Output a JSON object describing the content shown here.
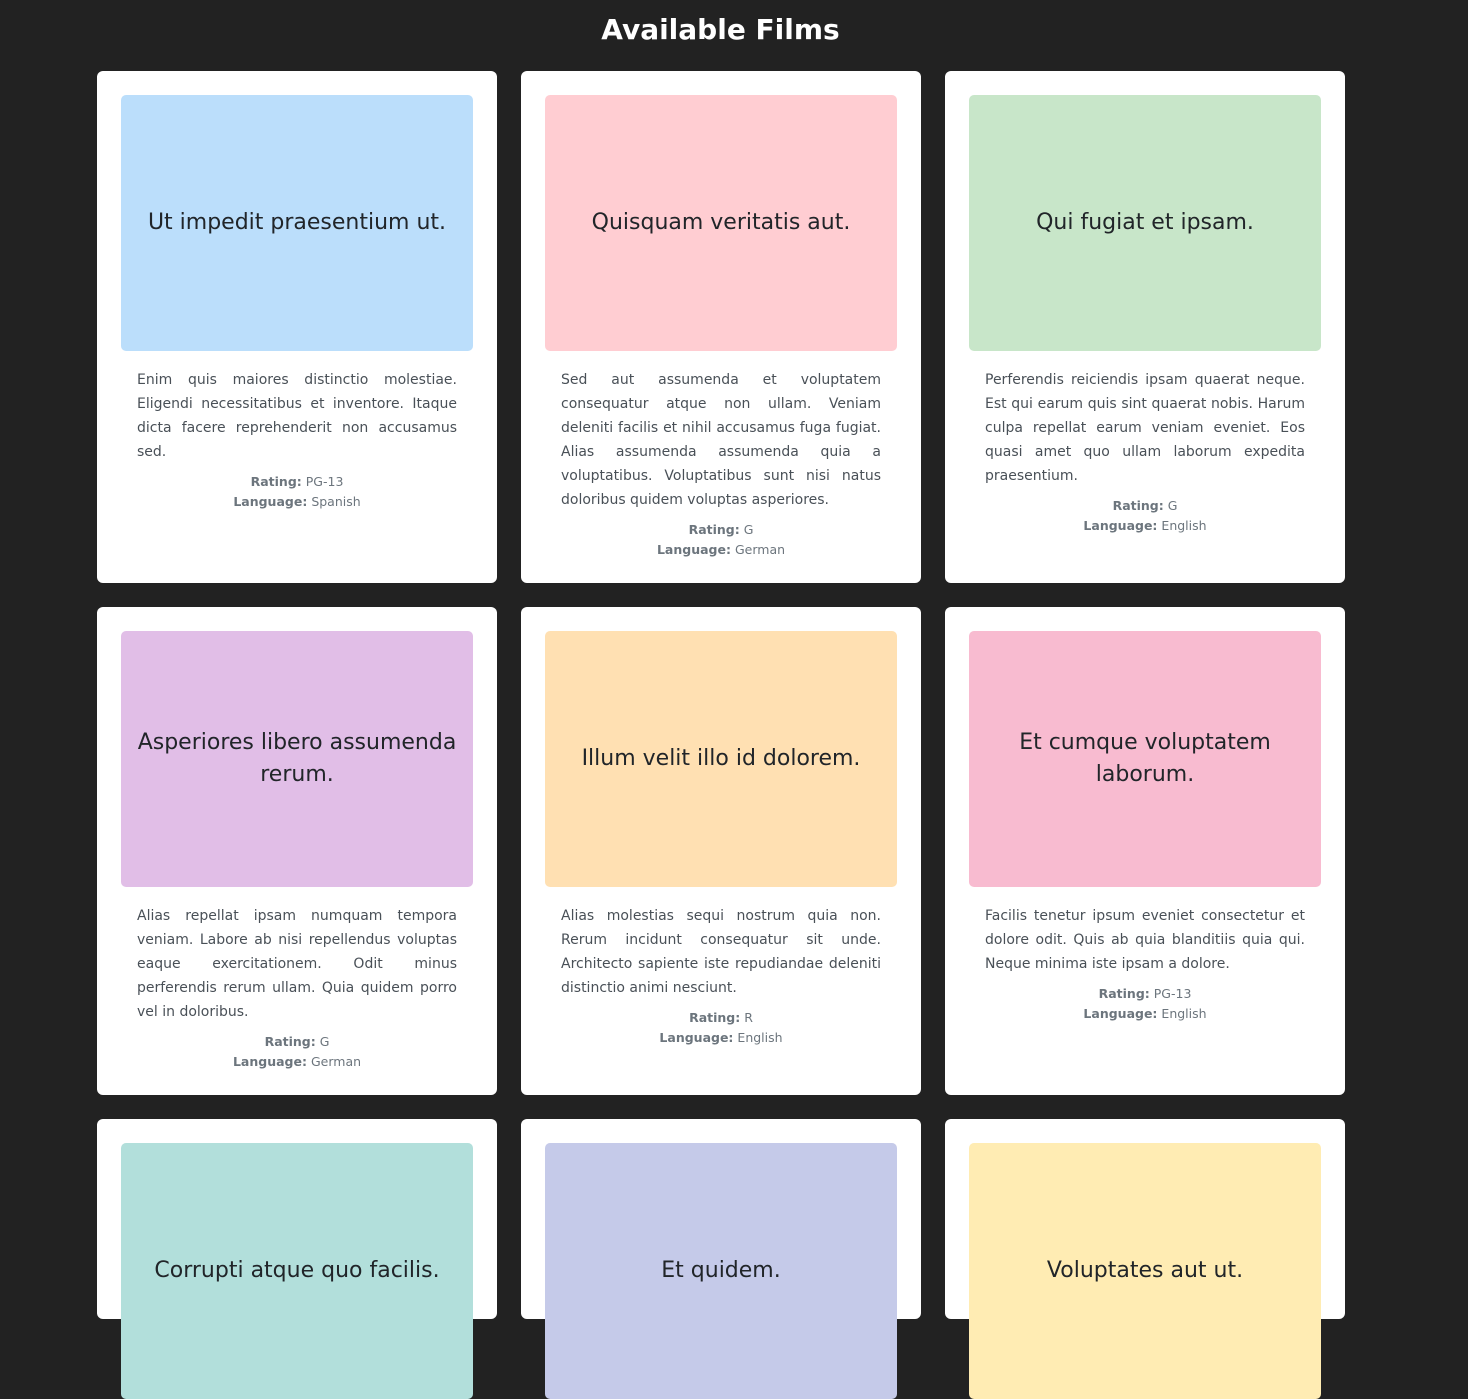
{
  "header": {
    "title": "Available Films"
  },
  "labels": {
    "rating": "Rating:",
    "language": "Language:"
  },
  "films": [
    {
      "title": "Ut impedit praesentium ut.",
      "color": "#bbdefb",
      "description": "Enim quis maiores distinctio molestiae. Eligendi necessitatibus et inventore. Itaque dicta facere reprehenderit non accusamus sed.",
      "rating": "PG-13",
      "language": "Spanish"
    },
    {
      "title": "Quisquam veritatis aut.",
      "color": "#ffcdd2",
      "description": "Sed aut assumenda et voluptatem consequatur atque non ullam. Veniam deleniti facilis et nihil accusamus fuga fugiat. Alias assumenda assumenda quia a voluptatibus. Voluptatibus sunt nisi natus doloribus quidem voluptas asperiores.",
      "rating": "G",
      "language": "German"
    },
    {
      "title": "Qui fugiat et ipsam.",
      "color": "#c8e6c9",
      "description": "Perferendis reiciendis ipsam quaerat neque. Est qui earum quis sint quaerat nobis. Harum culpa repellat earum veniam eveniet. Eos quasi amet quo ullam laborum expedita praesentium.",
      "rating": "G",
      "language": "English"
    },
    {
      "title": "Asperiores libero assumenda rerum.",
      "color": "#e1bee7",
      "description": "Alias repellat ipsam numquam tempora veniam. Labore ab nisi repellendus voluptas eaque exercitationem. Odit minus perferendis rerum ullam. Quia quidem porro vel in doloribus.",
      "rating": "G",
      "language": "German"
    },
    {
      "title": "Illum velit illo id dolorem.",
      "color": "#ffe0b2",
      "description": "Alias molestias sequi nostrum quia non. Rerum incidunt consequatur sit unde. Architecto sapiente iste repudiandae deleniti distinctio animi nesciunt.",
      "rating": "R",
      "language": "English"
    },
    {
      "title": "Et cumque voluptatem laborum.",
      "color": "#f8bbd0",
      "description": "Facilis tenetur ipsum eveniet consectetur et dolore odit. Quis ab quia blanditiis quia qui. Neque minima iste ipsam a dolore.",
      "rating": "PG-13",
      "language": "English"
    },
    {
      "title": "Corrupti atque quo facilis.",
      "color": "#b2dfdb"
    },
    {
      "title": "Et quidem.",
      "color": "#c5cae9"
    },
    {
      "title": "Voluptates aut ut.",
      "color": "#ffecb3"
    }
  ]
}
